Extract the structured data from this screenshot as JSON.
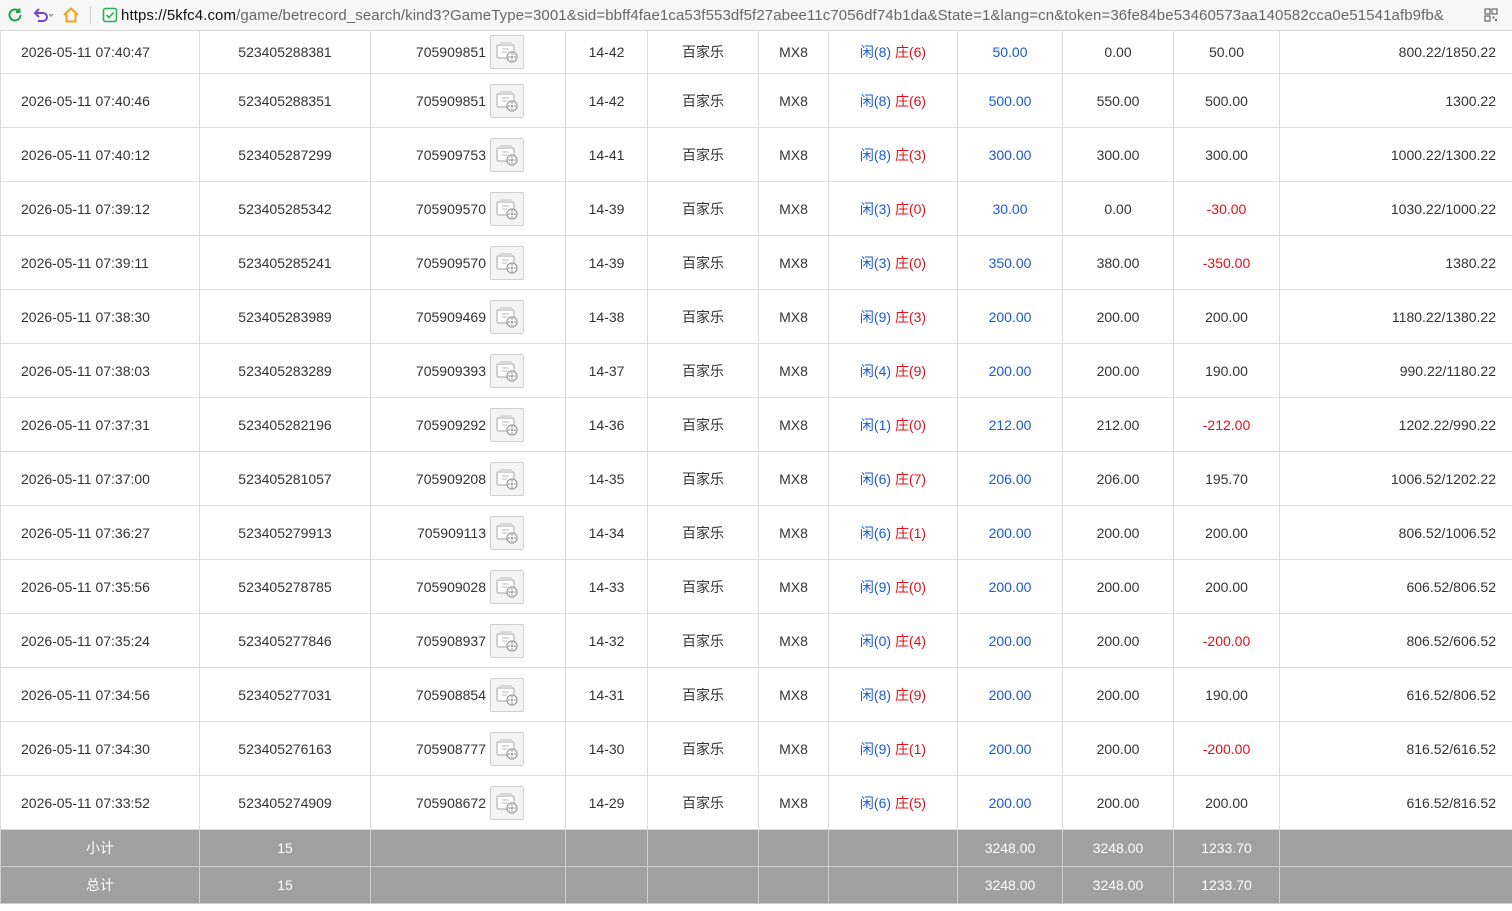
{
  "browser": {
    "url_host": "https://5kfc4.com",
    "url_rest": "/game/betrecord_search/kind3?GameType=3001&sid=bbff4fae1ca53f553df5f27abee11c7056df74b1da&State=1&lang=cn&token=36fe84be53460573aa140582cca0e51541afb9fb&"
  },
  "colors": {
    "blue": "#1a5ad8",
    "red": "#e0101a",
    "summary_bg": "#a0a0a0"
  },
  "icons": [
    "refresh-icon",
    "undo-icon",
    "home-icon",
    "shield-icon",
    "video-replay-icon",
    "qr-code-icon"
  ],
  "rows": [
    {
      "time": "2026-05-11 07:40:47",
      "order": "523405288381",
      "round": "705909851",
      "table": "14-42",
      "game": "百家乐",
      "room": "MX8",
      "xian": "闲(8)",
      "zhuang": "庄(6)",
      "bet": "50.00",
      "valid": "0.00",
      "win": "50.00",
      "win_neg": false,
      "balance": "800.22/1850.22"
    },
    {
      "time": "2026-05-11 07:40:46",
      "order": "523405288351",
      "round": "705909851",
      "table": "14-42",
      "game": "百家乐",
      "room": "MX8",
      "xian": "闲(8)",
      "zhuang": "庄(6)",
      "bet": "500.00",
      "valid": "550.00",
      "win": "500.00",
      "win_neg": false,
      "balance": "1300.22"
    },
    {
      "time": "2026-05-11 07:40:12",
      "order": "523405287299",
      "round": "705909753",
      "table": "14-41",
      "game": "百家乐",
      "room": "MX8",
      "xian": "闲(8)",
      "zhuang": "庄(3)",
      "bet": "300.00",
      "valid": "300.00",
      "win": "300.00",
      "win_neg": false,
      "balance": "1000.22/1300.22"
    },
    {
      "time": "2026-05-11 07:39:12",
      "order": "523405285342",
      "round": "705909570",
      "table": "14-39",
      "game": "百家乐",
      "room": "MX8",
      "xian": "闲(3)",
      "zhuang": "庄(0)",
      "bet": "30.00",
      "valid": "0.00",
      "win": "-30.00",
      "win_neg": true,
      "balance": "1030.22/1000.22"
    },
    {
      "time": "2026-05-11 07:39:11",
      "order": "523405285241",
      "round": "705909570",
      "table": "14-39",
      "game": "百家乐",
      "room": "MX8",
      "xian": "闲(3)",
      "zhuang": "庄(0)",
      "bet": "350.00",
      "valid": "380.00",
      "win": "-350.00",
      "win_neg": true,
      "balance": "1380.22"
    },
    {
      "time": "2026-05-11 07:38:30",
      "order": "523405283989",
      "round": "705909469",
      "table": "14-38",
      "game": "百家乐",
      "room": "MX8",
      "xian": "闲(9)",
      "zhuang": "庄(3)",
      "bet": "200.00",
      "valid": "200.00",
      "win": "200.00",
      "win_neg": false,
      "balance": "1180.22/1380.22"
    },
    {
      "time": "2026-05-11 07:38:03",
      "order": "523405283289",
      "round": "705909393",
      "table": "14-37",
      "game": "百家乐",
      "room": "MX8",
      "xian": "闲(4)",
      "zhuang": "庄(9)",
      "bet": "200.00",
      "valid": "200.00",
      "win": "190.00",
      "win_neg": false,
      "balance": "990.22/1180.22"
    },
    {
      "time": "2026-05-11 07:37:31",
      "order": "523405282196",
      "round": "705909292",
      "table": "14-36",
      "game": "百家乐",
      "room": "MX8",
      "xian": "闲(1)",
      "zhuang": "庄(0)",
      "bet": "212.00",
      "valid": "212.00",
      "win": "-212.00",
      "win_neg": true,
      "balance": "1202.22/990.22"
    },
    {
      "time": "2026-05-11 07:37:00",
      "order": "523405281057",
      "round": "705909208",
      "table": "14-35",
      "game": "百家乐",
      "room": "MX8",
      "xian": "闲(6)",
      "zhuang": "庄(7)",
      "bet": "206.00",
      "valid": "206.00",
      "win": "195.70",
      "win_neg": false,
      "balance": "1006.52/1202.22"
    },
    {
      "time": "2026-05-11 07:36:27",
      "order": "523405279913",
      "round": "705909113",
      "table": "14-34",
      "game": "百家乐",
      "room": "MX8",
      "xian": "闲(6)",
      "zhuang": "庄(1)",
      "bet": "200.00",
      "valid": "200.00",
      "win": "200.00",
      "win_neg": false,
      "balance": "806.52/1006.52"
    },
    {
      "time": "2026-05-11 07:35:56",
      "order": "523405278785",
      "round": "705909028",
      "table": "14-33",
      "game": "百家乐",
      "room": "MX8",
      "xian": "闲(9)",
      "zhuang": "庄(0)",
      "bet": "200.00",
      "valid": "200.00",
      "win": "200.00",
      "win_neg": false,
      "balance": "606.52/806.52"
    },
    {
      "time": "2026-05-11 07:35:24",
      "order": "523405277846",
      "round": "705908937",
      "table": "14-32",
      "game": "百家乐",
      "room": "MX8",
      "xian": "闲(0)",
      "zhuang": "庄(4)",
      "bet": "200.00",
      "valid": "200.00",
      "win": "-200.00",
      "win_neg": true,
      "balance": "806.52/606.52"
    },
    {
      "time": "2026-05-11 07:34:56",
      "order": "523405277031",
      "round": "705908854",
      "table": "14-31",
      "game": "百家乐",
      "room": "MX8",
      "xian": "闲(8)",
      "zhuang": "庄(9)",
      "bet": "200.00",
      "valid": "200.00",
      "win": "190.00",
      "win_neg": false,
      "balance": "616.52/806.52"
    },
    {
      "time": "2026-05-11 07:34:30",
      "order": "523405276163",
      "round": "705908777",
      "table": "14-30",
      "game": "百家乐",
      "room": "MX8",
      "xian": "闲(9)",
      "zhuang": "庄(1)",
      "bet": "200.00",
      "valid": "200.00",
      "win": "-200.00",
      "win_neg": true,
      "balance": "816.52/616.52"
    },
    {
      "time": "2026-05-11 07:33:52",
      "order": "523405274909",
      "round": "705908672",
      "table": "14-29",
      "game": "百家乐",
      "room": "MX8",
      "xian": "闲(6)",
      "zhuang": "庄(5)",
      "bet": "200.00",
      "valid": "200.00",
      "win": "200.00",
      "win_neg": false,
      "balance": "616.52/816.52"
    }
  ],
  "subtotal": {
    "label": "小计",
    "count": "15",
    "bet": "3248.00",
    "valid": "3248.00",
    "win": "1233.70"
  },
  "total": {
    "label": "总计",
    "count": "15",
    "bet": "3248.00",
    "valid": "3248.00",
    "win": "1233.70"
  }
}
